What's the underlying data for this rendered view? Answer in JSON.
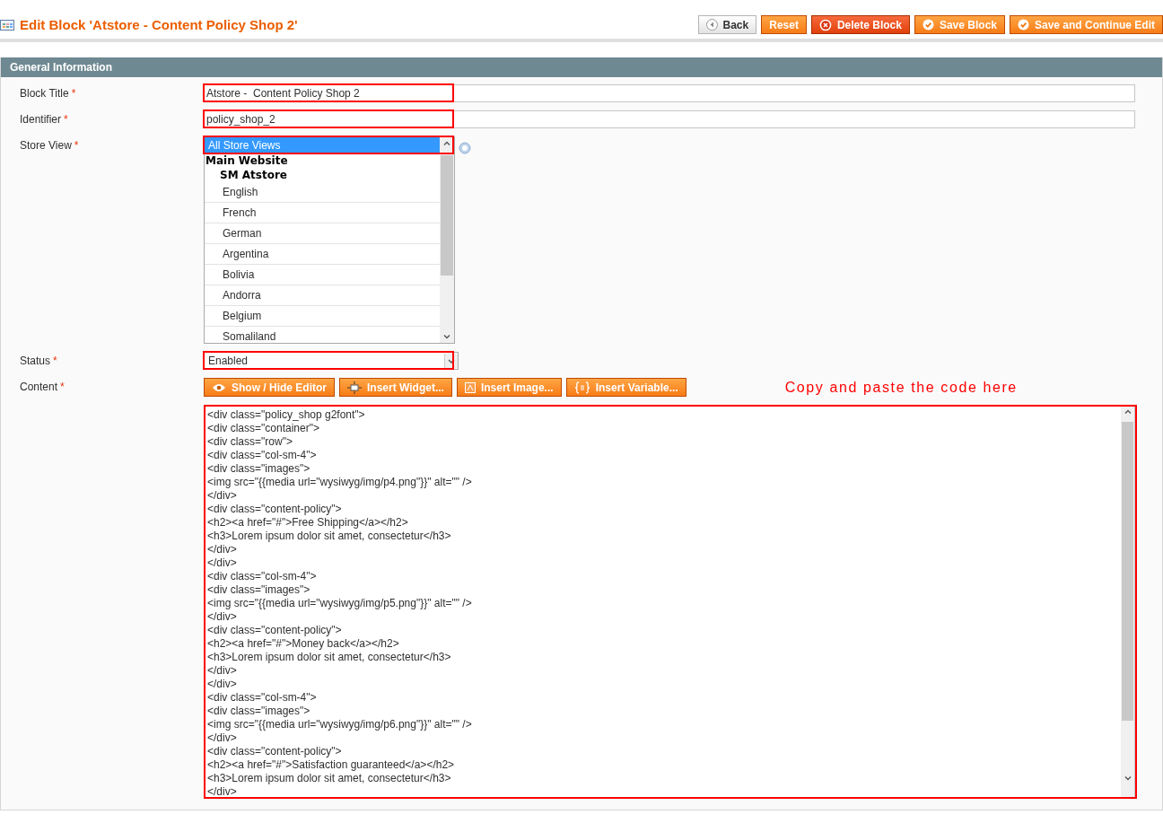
{
  "page_title": "Edit Block 'Atstore - Content Policy Shop 2'",
  "buttons": [
    {
      "label": "Back",
      "kind": "back"
    },
    {
      "label": "Reset",
      "kind": "plain"
    },
    {
      "label": "Delete Block",
      "kind": "delete"
    },
    {
      "label": "Save Block",
      "kind": "save"
    },
    {
      "label": "Save and Continue Edit",
      "kind": "save"
    }
  ],
  "section": {
    "title": "General Information"
  },
  "fields": [
    {
      "label": "Block Title",
      "required": "*",
      "kind": "text",
      "value": "Atstore -  Content Policy Shop 2",
      "highlighted": true
    },
    {
      "label": "Identifier",
      "required": "*",
      "kind": "text",
      "value": "policy_shop_2",
      "highlighted": true
    },
    {
      "label": "Store View",
      "required": "*",
      "kind": "multiselect",
      "highlighted": true,
      "options": [
        {
          "label": "All Store Views",
          "selected": true
        },
        {
          "label": "Main Website",
          "kind": "group",
          "children": [
            {
              "label": "SM Atstore",
              "kind": "group",
              "children": [
                {
                  "label": "English",
                  "selected": false
                },
                {
                  "label": "French",
                  "selected": false
                },
                {
                  "label": "German",
                  "selected": false
                },
                {
                  "label": "Argentina",
                  "selected": false
                },
                {
                  "label": "Bolivia",
                  "selected": false
                },
                {
                  "label": "Andorra",
                  "selected": false
                },
                {
                  "label": "Belgium",
                  "selected": false
                },
                {
                  "label": "Somaliland",
                  "selected": false
                }
              ]
            }
          ]
        }
      ]
    },
    {
      "label": "Status",
      "required": "*",
      "kind": "select",
      "value": "Enabled",
      "highlighted": true
    },
    {
      "label": "Content",
      "required": "*",
      "kind": "editor",
      "highlighted": true,
      "editor_buttons": [
        {
          "label": "Show / Hide Editor"
        },
        {
          "label": "Insert Widget..."
        },
        {
          "label": "Insert Image..."
        },
        {
          "label": "Insert Variable..."
        }
      ],
      "note": "Copy and paste the code here",
      "value": "<div class=\"policy_shop g2font\">\n<div class=\"container\">\n<div class=\"row\">\n<div class=\"col-sm-4\">\n<div class=\"images\">\n<img src=\"{{media url=\"wysiwyg/img/p4.png\"}}\" alt=\"\" />\n</div>\n<div class=\"content-policy\">\n<h2><a href=\"#\">Free Shipping</a></h2>\n<h3>Lorem ipsum dolor sit amet, consectetur</h3>\n</div>\n</div>\n<div class=\"col-sm-4\">\n<div class=\"images\">\n<img src=\"{{media url=\"wysiwyg/img/p5.png\"}}\" alt=\"\" />\n</div>\n<div class=\"content-policy\">\n<h2><a href=\"#\">Money back</a></h2>\n<h3>Lorem ipsum dolor sit amet, consectetur</h3>\n</div>\n</div>\n<div class=\"col-sm-4\">\n<div class=\"images\">\n<img src=\"{{media url=\"wysiwyg/img/p6.png\"}}\" alt=\"\" />\n</div>\n<div class=\"content-policy\">\n<h2><a href=\"#\">Satisfaction guaranteed</a></h2>\n<h3>Lorem ipsum dolor sit amet, consectetur</h3>\n</div>"
    }
  ]
}
